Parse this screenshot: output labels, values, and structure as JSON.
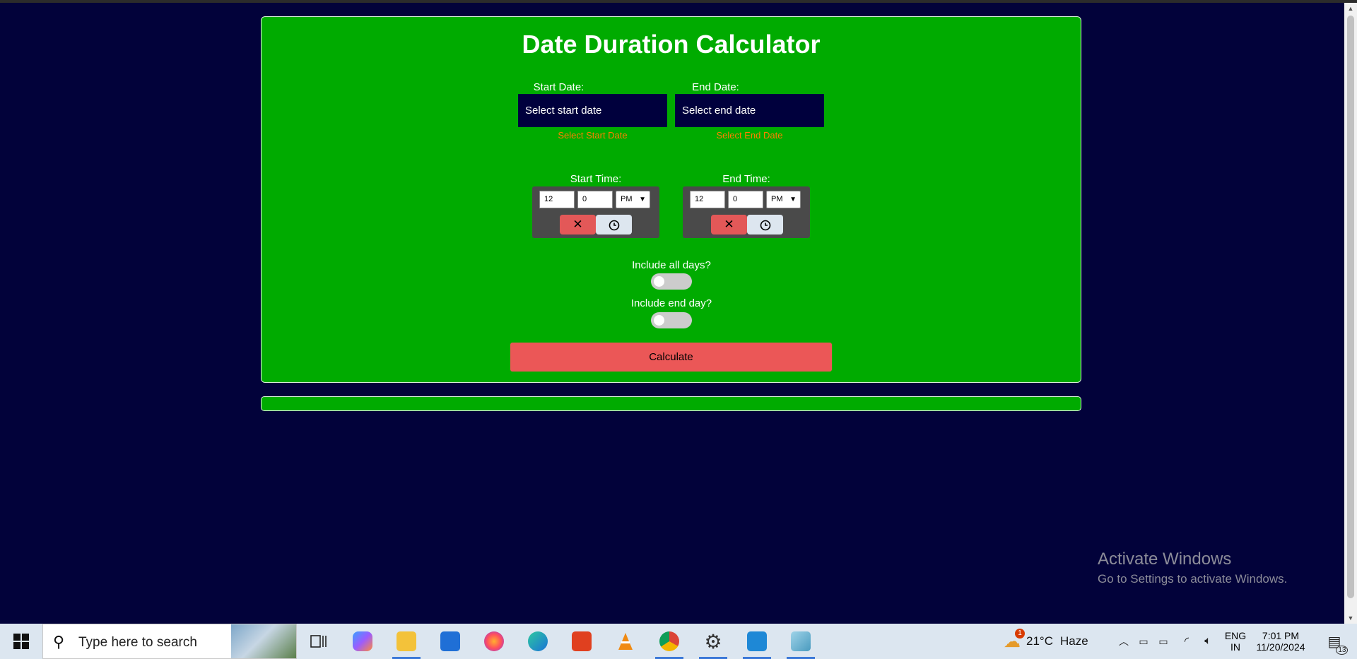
{
  "calculator": {
    "title": "Date Duration Calculator",
    "start_date": {
      "label": "Start Date:",
      "placeholder": "Select start date",
      "hint": "Select Start Date"
    },
    "end_date": {
      "label": "End Date:",
      "placeholder": "Select end date",
      "hint": "Select End Date"
    },
    "start_time": {
      "label": "Start Time:",
      "hour": "12",
      "minute": "0",
      "ampm": "PM"
    },
    "end_time": {
      "label": "End Time:",
      "hour": "12",
      "minute": "0",
      "ampm": "PM"
    },
    "include_all_days": {
      "label": "Include all days?",
      "checked": false
    },
    "include_end_day": {
      "label": "Include end day?",
      "checked": false
    },
    "calculate_label": "Calculate"
  },
  "watermark": {
    "line1": "Activate Windows",
    "line2": "Go to Settings to activate Windows."
  },
  "taskbar": {
    "search_placeholder": "Type here to search",
    "weather": {
      "temp": "21°C",
      "condition": "Haze",
      "badge": "1"
    },
    "language": {
      "line1": "ENG",
      "line2": "IN"
    },
    "clock": {
      "time": "7:01 PM",
      "date": "11/20/2024"
    },
    "notification_count": "13",
    "apps": [
      "task-view",
      "copilot",
      "file-explorer",
      "mail",
      "firefox",
      "edge",
      "office",
      "vlc",
      "chrome",
      "settings",
      "vscode",
      "eraser-app"
    ]
  },
  "colors": {
    "page_bg": "#02023a",
    "card_bg": "#00ab00",
    "input_bg": "#00003d",
    "hint": "#ff7f00",
    "calculate_bg": "#eb5757",
    "taskbar_bg": "#dce6f0"
  }
}
